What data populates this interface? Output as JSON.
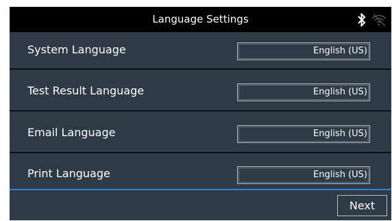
{
  "header": {
    "title": "Language Settings",
    "icons": [
      "bluetooth-icon",
      "wifi-off-icon"
    ]
  },
  "settings": [
    {
      "label": "System Language",
      "value": "English (US)"
    },
    {
      "label": "Test Result Language",
      "value": "English (US)"
    },
    {
      "label": "Email Language",
      "value": "English (US)"
    },
    {
      "label": "Print Language",
      "value": "English (US)"
    }
  ],
  "footer": {
    "next_label": "Next"
  },
  "colors": {
    "background": "#2e3a45",
    "titlebar": "#000000",
    "accent_line": "#2f86d8",
    "text": "#ffffff"
  }
}
